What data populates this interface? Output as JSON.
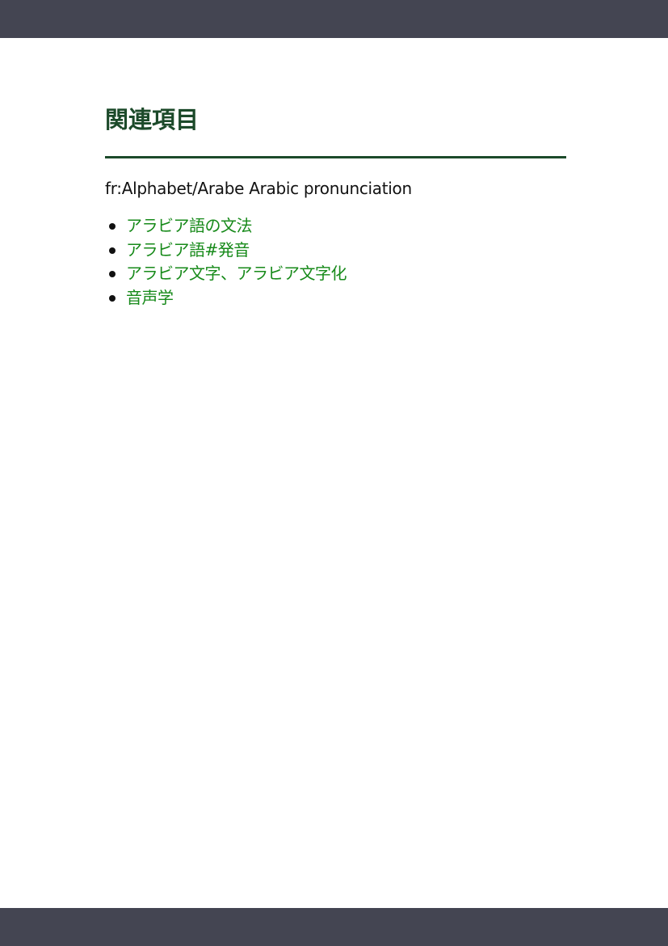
{
  "section": {
    "heading": "関連項目",
    "reference_text": "fr:Alphabet/Arabe Arabic pronunciation",
    "links": [
      {
        "label": "アラビア語の文法"
      },
      {
        "label": "アラビア語#発音"
      },
      {
        "label": "アラビア文字、アラビア文字化"
      },
      {
        "label": "音声学"
      }
    ]
  },
  "colors": {
    "header_bar": "#444552",
    "heading": "#1c4a2a",
    "link": "#178a1a",
    "text": "#111111"
  }
}
